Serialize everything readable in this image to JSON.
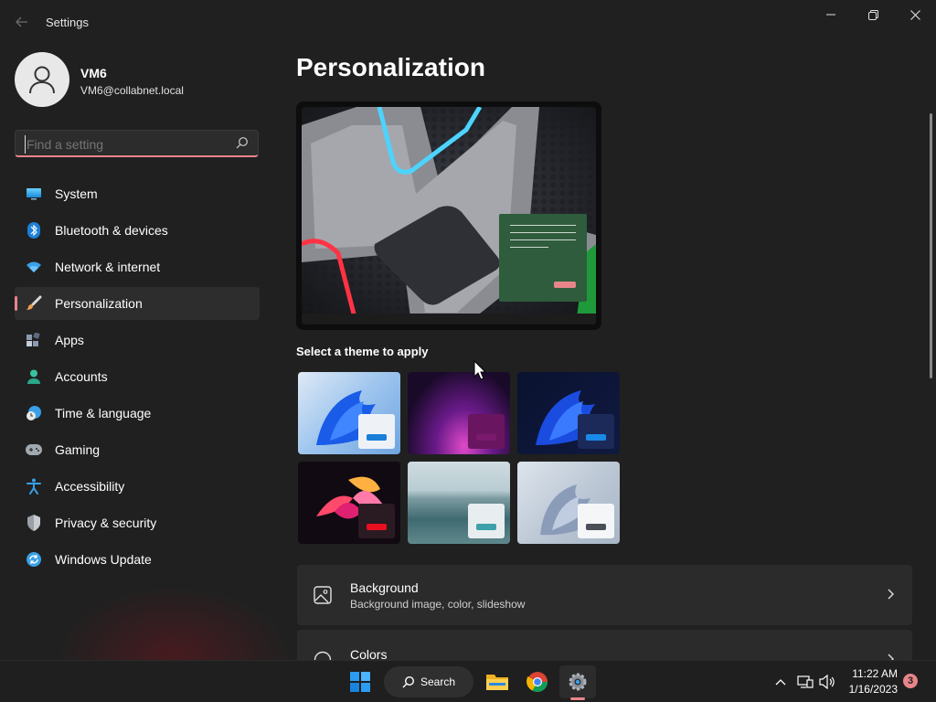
{
  "app": {
    "title": "Settings"
  },
  "profile": {
    "name": "VM6",
    "email": "VM6@collabnet.local"
  },
  "search": {
    "placeholder": "Find a setting",
    "value": ""
  },
  "nav": {
    "items": [
      {
        "label": "System",
        "icon": "monitor-icon"
      },
      {
        "label": "Bluetooth & devices",
        "icon": "bluetooth-icon"
      },
      {
        "label": "Network & internet",
        "icon": "wifi-icon"
      },
      {
        "label": "Personalization",
        "icon": "brush-icon",
        "active": true
      },
      {
        "label": "Apps",
        "icon": "apps-icon"
      },
      {
        "label": "Accounts",
        "icon": "person-icon"
      },
      {
        "label": "Time & language",
        "icon": "clock-globe-icon"
      },
      {
        "label": "Gaming",
        "icon": "gamepad-icon"
      },
      {
        "label": "Accessibility",
        "icon": "accessibility-icon"
      },
      {
        "label": "Privacy & security",
        "icon": "shield-icon"
      },
      {
        "label": "Windows Update",
        "icon": "update-icon"
      }
    ]
  },
  "main": {
    "title": "Personalization",
    "themes_label": "Select a theme to apply",
    "cards": [
      {
        "title": "Background",
        "subtitle": "Background image, color, slideshow",
        "icon": "image-icon"
      },
      {
        "title": "Colors",
        "subtitle": "",
        "icon": "palette-icon"
      }
    ]
  },
  "taskbar": {
    "search_label": "Search",
    "time": "11:22 AM",
    "date": "1/16/2023",
    "notification_count": "3"
  },
  "colors": {
    "accent": "#e8858a",
    "background": "#202020",
    "card": "#2b2b2b"
  }
}
